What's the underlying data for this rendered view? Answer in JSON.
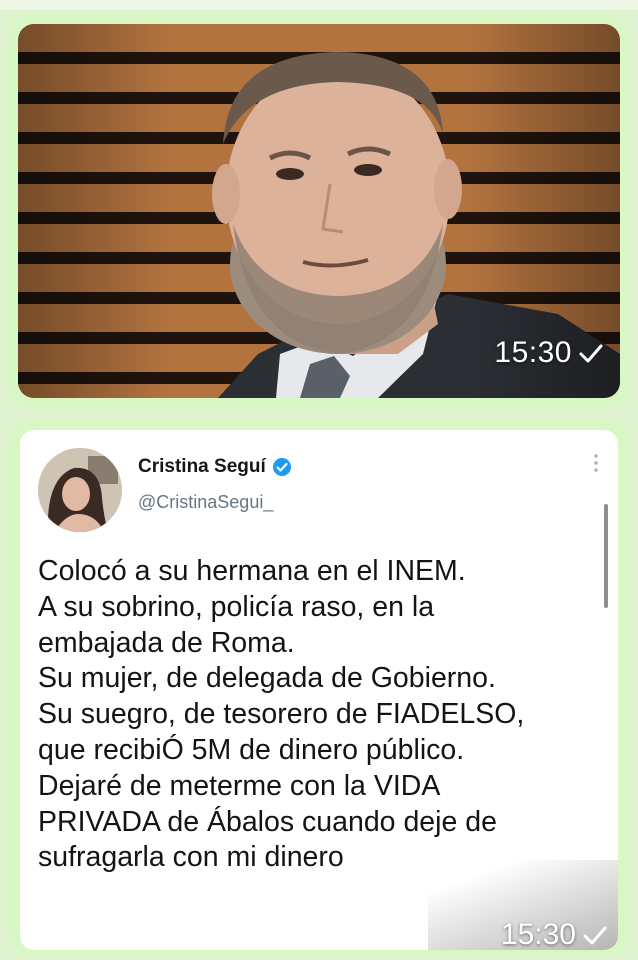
{
  "photo_message": {
    "time": "15:30",
    "status_icon": "single-check-icon"
  },
  "tweet_message": {
    "author_name": "Cristina Seguí",
    "verified_icon": "verified-badge-icon",
    "handle": "@CristinaSegui_",
    "menu_icon": "more-vertical-icon",
    "lines": [
      "Colocó a su hermana en el INEM.",
      "A su sobrino, policía raso, en la",
      "embajada de Roma.",
      "Su mujer, de delegada de Gobierno.",
      "Su suegro, de tesorero de FIADELSO,",
      "que recibiÓ 5M de dinero público.",
      "Dejaré de meterme con la VIDA",
      "PRIVADA de Ábalos cuando deje de",
      "sufragarla con mi dinero"
    ],
    "time": "15:30",
    "status_icon": "single-check-icon"
  },
  "colors": {
    "bubble": "#d9f7c5",
    "verified": "#1d9bf0",
    "handle": "#657786"
  }
}
